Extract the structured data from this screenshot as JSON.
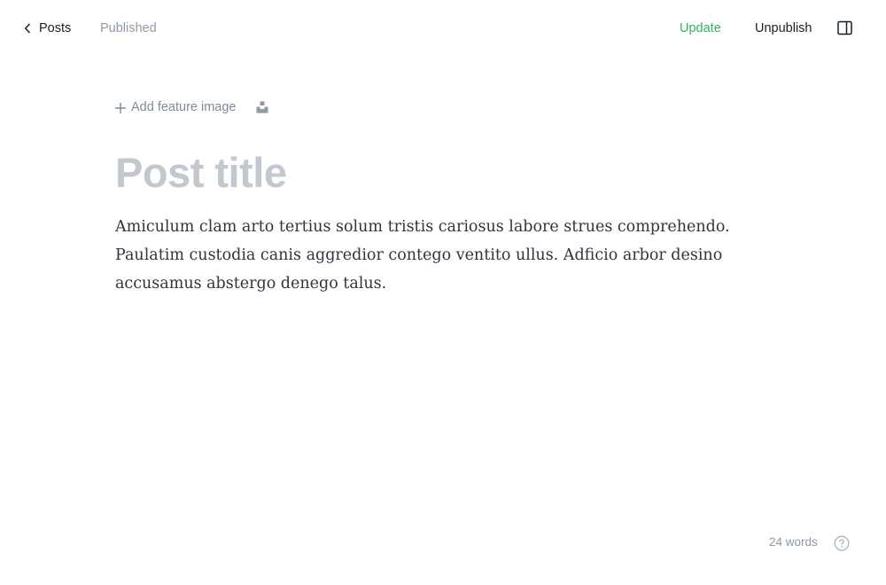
{
  "topbar": {
    "back_label": "Posts",
    "status": "Published",
    "update_label": "Update",
    "unpublish_label": "Unpublish",
    "icons": {
      "back": "chevron-left-icon",
      "settings": "sidebar-panel-icon"
    }
  },
  "editor": {
    "add_feature_label": "Add feature image",
    "title_placeholder": "Post title",
    "body": "Amiculum clam arto tertius solum tristis cariosus labore strues comprehendo. Paulatim custodia canis aggredior contego ventito ullus. Adficio arbor desino accusamus abstergo denego talus.",
    "icons": {
      "add": "plus-icon",
      "unsplash": "unsplash-icon"
    }
  },
  "footer": {
    "word_count": "24 words",
    "help_icon": "question-circle-icon"
  },
  "colors": {
    "accent_green": "#30b45a",
    "muted_text": "#8e9aa6",
    "title_placeholder": "#c2c8cd",
    "body_text": "#2c3641"
  }
}
